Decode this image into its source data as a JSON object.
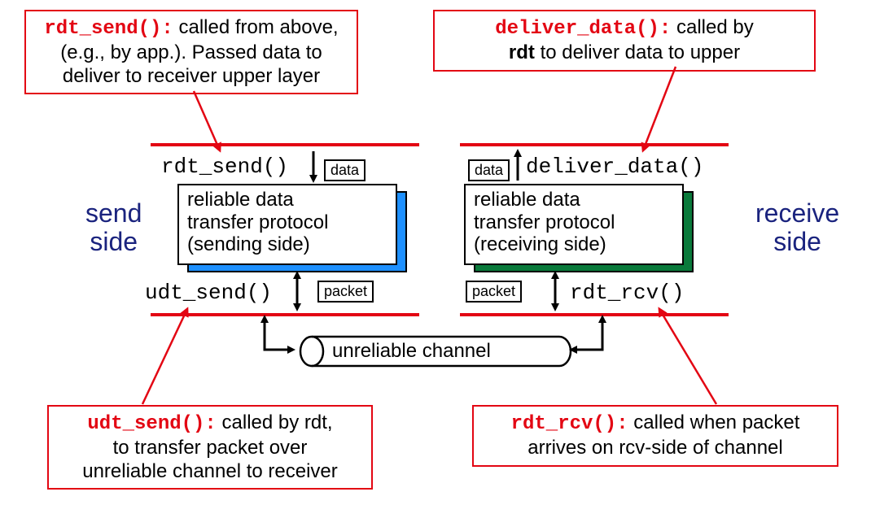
{
  "callouts": {
    "rdt_send": {
      "code": "rdt_send():",
      "text_line1": " called from above,",
      "text_line2": "(e.g., by app.). Passed data to",
      "text_line3": "deliver to receiver upper layer"
    },
    "deliver_data": {
      "code": "deliver_data():",
      "text_line1": " called by",
      "bold_word": "rdt",
      "text_line2": " to deliver data to upper"
    },
    "udt_send": {
      "code": "udt_send():",
      "text_line1": " called by rdt,",
      "text_line2": "to transfer packet over",
      "text_line3": "unreliable channel to receiver"
    },
    "rdt_rcv": {
      "code": "rdt_rcv():",
      "text_line1": " called when packet",
      "text_line2": "arrives on rcv-side of channel"
    }
  },
  "diagram": {
    "send_side_label": "send\nside",
    "receive_side_label": "receive\nside",
    "rdt_send_label": "rdt_send()",
    "deliver_data_label": "deliver_data()",
    "udt_send_label": "udt_send()",
    "rdt_rcv_label": "rdt_rcv()",
    "data_label": "data",
    "packet_label": "packet",
    "send_box_line1": "reliable data",
    "send_box_line2": "transfer protocol",
    "send_box_line3": "(sending side)",
    "recv_box_line1": "reliable data",
    "recv_box_line2": "transfer protocol",
    "recv_box_line3": "(receiving side)",
    "channel_label": "unreliable channel"
  }
}
